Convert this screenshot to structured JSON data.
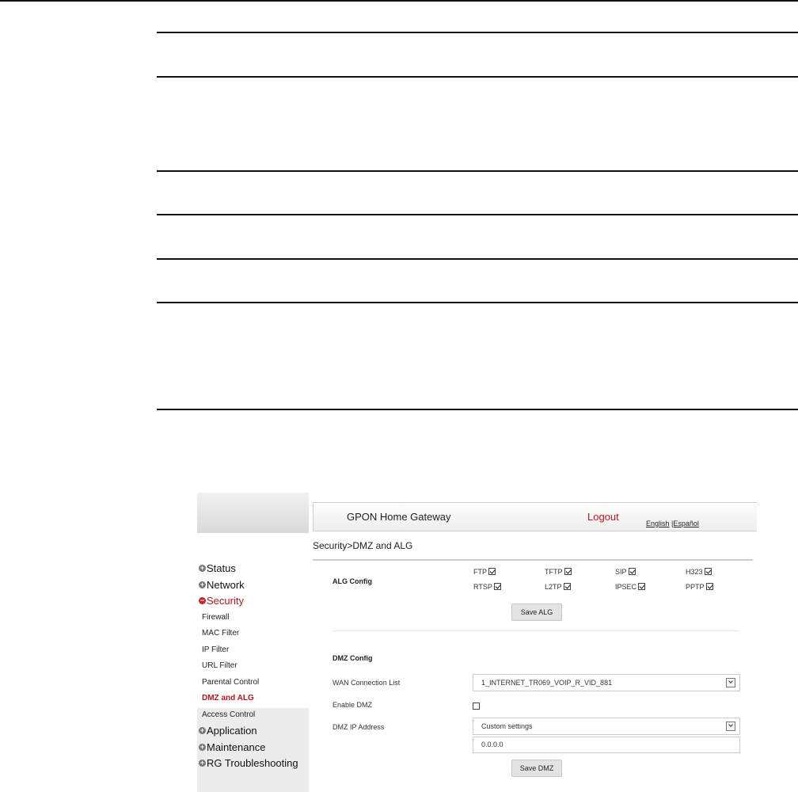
{
  "header": {
    "title": "GPON Home Gateway",
    "logout": "Logout",
    "lang_english": "English",
    "lang_spanish": "|Español"
  },
  "breadcrumb": "Security>DMZ and ALG",
  "sidebar": {
    "items": [
      {
        "label": "Status",
        "expanded": false
      },
      {
        "label": "Network",
        "expanded": false
      },
      {
        "label": "Security",
        "expanded": true
      },
      {
        "label": "Application",
        "expanded": false
      },
      {
        "label": "Maintenance",
        "expanded": false
      },
      {
        "label": "RG Troubleshooting",
        "expanded": false
      }
    ],
    "security_sub": [
      "Firewall",
      "MAC Filter",
      "IP Filter",
      "URL Filter",
      "Parental Control",
      "DMZ and ALG",
      "Access Control"
    ],
    "current": "DMZ and ALG"
  },
  "alg": {
    "title": "ALG Config",
    "options": [
      {
        "label": "FTP",
        "checked": true
      },
      {
        "label": "TFTP",
        "checked": true
      },
      {
        "label": "SIP",
        "checked": true
      },
      {
        "label": "H323",
        "checked": true
      },
      {
        "label": "RTSP",
        "checked": true
      },
      {
        "label": "L2TP",
        "checked": true
      },
      {
        "label": "IPSEC",
        "checked": true
      },
      {
        "label": "PPTP",
        "checked": true
      }
    ],
    "save_label": "Save ALG"
  },
  "dmz": {
    "title": "DMZ Config",
    "wan_label": "WAN Connection List",
    "wan_value": "1_INTERNET_TR069_VOIP_R_VID_881",
    "enable_label": "Enable DMZ",
    "enable_checked": false,
    "ip_label": "DMZ IP Address",
    "ip_mode": "Custom settings",
    "ip_value": "0.0.0.0",
    "save_label": "Save DMZ"
  }
}
